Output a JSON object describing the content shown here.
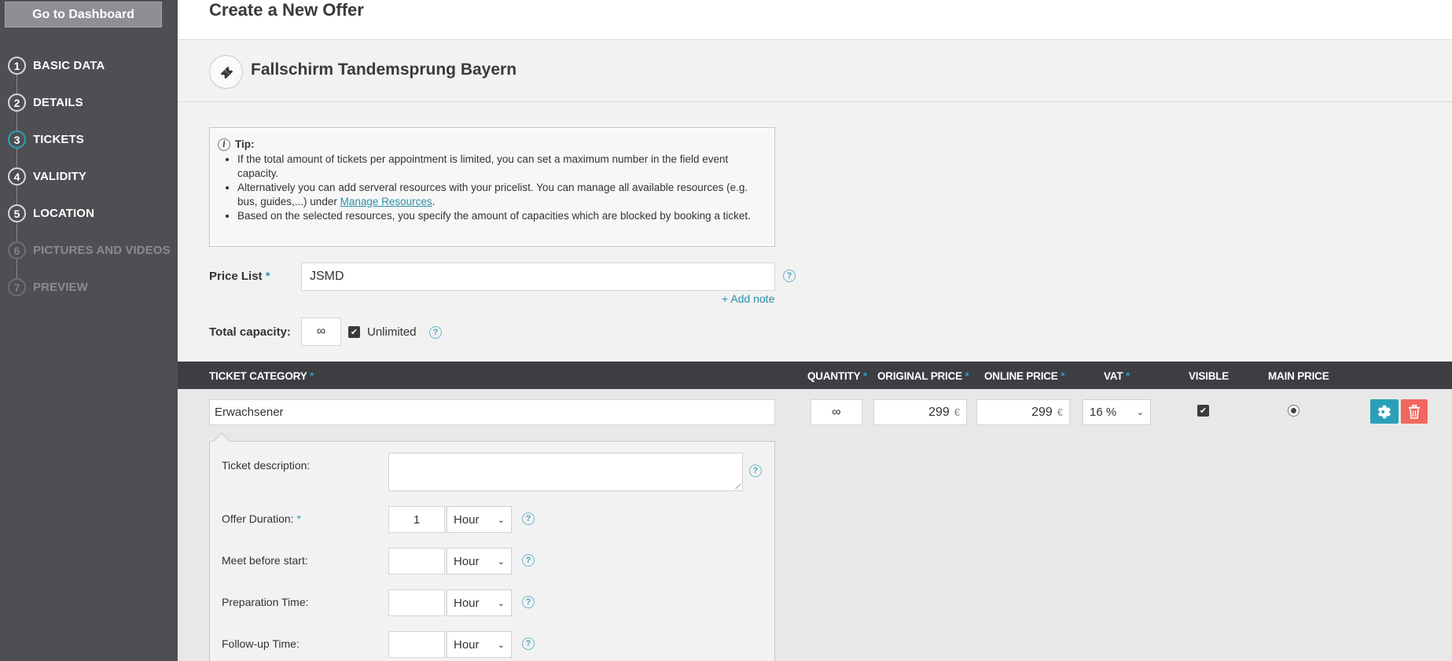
{
  "sidebar": {
    "dashboard_button": "Go to Dashboard",
    "steps": [
      {
        "num": "1",
        "label": "BASIC DATA"
      },
      {
        "num": "2",
        "label": "DETAILS"
      },
      {
        "num": "3",
        "label": "TICKETS"
      },
      {
        "num": "4",
        "label": "VALIDITY"
      },
      {
        "num": "5",
        "label": "LOCATION"
      },
      {
        "num": "6",
        "label": "PICTURES AND VIDEOS"
      },
      {
        "num": "7",
        "label": "PREVIEW"
      }
    ],
    "active_step": "3"
  },
  "header": {
    "title": "Create a New Offer",
    "offer_name": "Fallschirm Tandemsprung Bayern"
  },
  "tip": {
    "heading": "Tip:",
    "item1": "If the total amount of tickets per appointment is limited, you can set a maximum number in the field event capacity.",
    "item2_pre": "Alternatively you can add serveral resources with your pricelist. You can manage all available resources (e.g. bus, guides,...) under ",
    "item2_link": "Manage Resources",
    "item2_post": ".",
    "item3": "Based on the selected resources, you specify the amount of capacities which are blocked by booking a ticket."
  },
  "form": {
    "price_list_label": "Price List",
    "price_list_value": "JSMD",
    "add_note": "Add note",
    "total_capacity_label": "Total capacity:",
    "total_capacity_value": "∞",
    "unlimited_label": "Unlimited"
  },
  "table": {
    "headers": {
      "category": "TICKET CATEGORY",
      "quantity": "QUANTITY",
      "original_price": "ORIGINAL PRICE",
      "online_price": "ONLINE PRICE",
      "vat": "VAT",
      "visible": "VISIBLE",
      "main_price": "MAIN PRICE"
    },
    "required_mark": "*",
    "row": {
      "category": "Erwachsener",
      "quantity": "∞",
      "original_price": "299",
      "online_price": "299",
      "currency": "€",
      "vat": "16 %"
    }
  },
  "details": {
    "description_label": "Ticket description:",
    "duration_label": "Offer Duration:",
    "duration_value": "1",
    "meet_label": "Meet before start:",
    "prep_label": "Preparation Time:",
    "followup_label": "Follow-up Time:",
    "unit": "Hour"
  },
  "colors": {
    "sidebar": "#4e4f53",
    "accent": "#2aa0b8",
    "delete": "#f0675e",
    "table_header": "#3d3e41"
  }
}
